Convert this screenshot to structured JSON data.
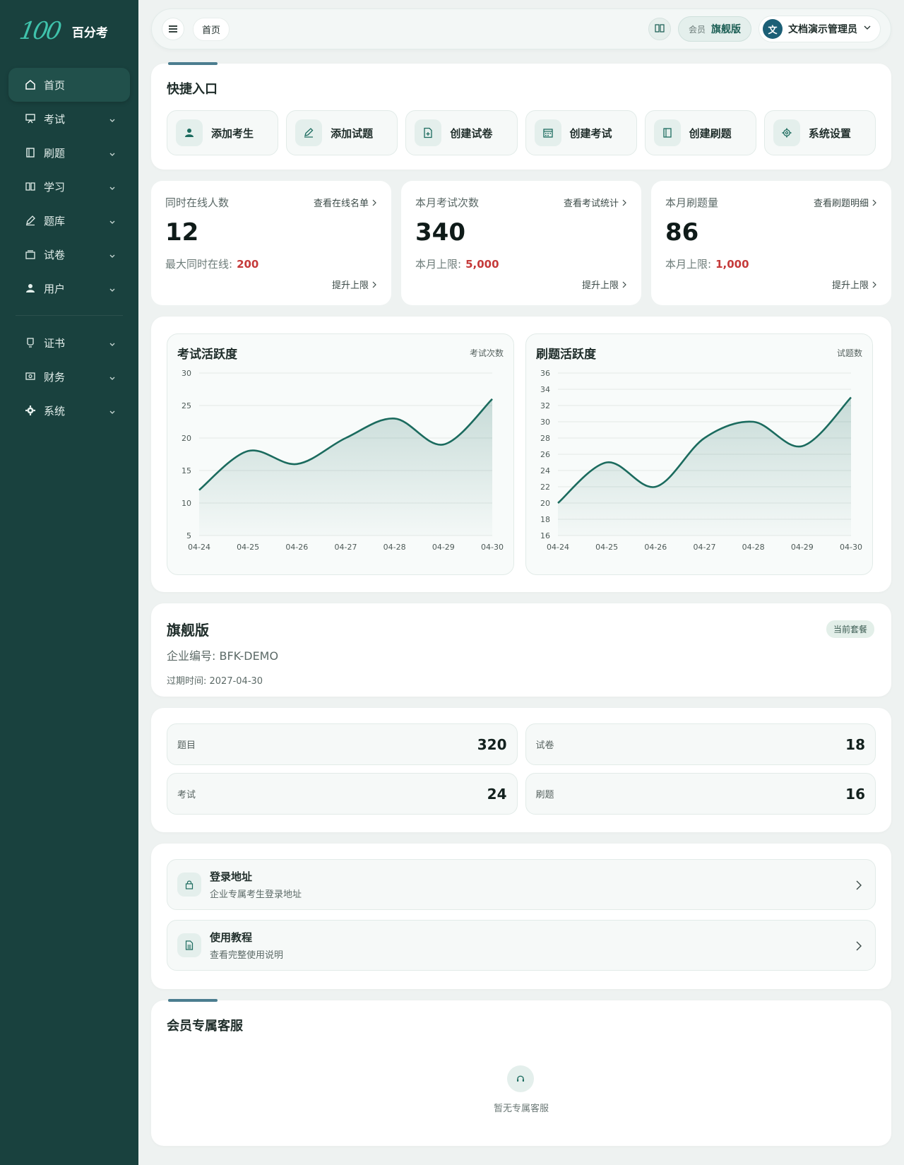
{
  "brand": {
    "logo_mark": "100",
    "name": "百分考"
  },
  "nav": [
    {
      "label": "首页",
      "icon": "home-icon",
      "active": true,
      "chevron": false
    },
    {
      "label": "考试",
      "icon": "presentation-icon",
      "chevron": true
    },
    {
      "label": "刷题",
      "icon": "notebook-icon",
      "chevron": true
    },
    {
      "label": "学习",
      "icon": "book-open-icon",
      "chevron": true
    },
    {
      "label": "题库",
      "icon": "pen-icon",
      "chevron": true
    },
    {
      "label": "试卷",
      "icon": "papers-icon",
      "chevron": true
    },
    {
      "label": "用户",
      "icon": "user-icon",
      "chevron": true
    },
    {
      "label": "证书",
      "icon": "certificate-icon",
      "chevron": true
    },
    {
      "label": "财务",
      "icon": "money-icon",
      "chevron": true
    },
    {
      "label": "系统",
      "icon": "gear-icon",
      "chevron": true
    }
  ],
  "topbar": {
    "breadcrumb": "首页",
    "member_label": "会员",
    "member_plan": "旗舰版",
    "avatar_letter": "文",
    "user_name": "文档演示管理员"
  },
  "quick": {
    "title": "快捷入口",
    "items": [
      {
        "label": "添加考生",
        "icon": "user-icon"
      },
      {
        "label": "添加试题",
        "icon": "pen-icon"
      },
      {
        "label": "创建试卷",
        "icon": "file-plus-icon"
      },
      {
        "label": "创建考试",
        "icon": "calendar-icon"
      },
      {
        "label": "创建刷题",
        "icon": "notebook-icon"
      },
      {
        "label": "系统设置",
        "icon": "gear-icon"
      }
    ]
  },
  "stats": [
    {
      "label": "同时在线人数",
      "link": "查看在线名单",
      "value": "12",
      "limit_label": "最大同时在线:",
      "limit_value": "200",
      "upgrade": "提升上限"
    },
    {
      "label": "本月考试次数",
      "link": "查看考试统计",
      "value": "340",
      "limit_label": "本月上限:",
      "limit_value": "5,000",
      "upgrade": "提升上限"
    },
    {
      "label": "本月刷题量",
      "link": "查看刷题明细",
      "value": "86",
      "limit_label": "本月上限:",
      "limit_value": "1,000",
      "upgrade": "提升上限"
    }
  ],
  "chart_data": [
    {
      "type": "area",
      "title": "考试活跃度",
      "unit": "考试次数",
      "categories": [
        "04-24",
        "04-25",
        "04-26",
        "04-27",
        "04-28",
        "04-29",
        "04-30"
      ],
      "values": [
        12,
        18,
        16,
        20,
        23,
        19,
        26
      ],
      "ylim": [
        5,
        30
      ],
      "yticks": [
        5,
        10,
        15,
        20,
        25,
        30
      ],
      "grid": true,
      "color": "#1b6b5e"
    },
    {
      "type": "area",
      "title": "刷题活跃度",
      "unit": "试题数",
      "categories": [
        "04-24",
        "04-25",
        "04-26",
        "04-27",
        "04-28",
        "04-29",
        "04-30"
      ],
      "values": [
        20,
        25,
        22,
        28,
        30,
        27,
        33
      ],
      "ylim": [
        16,
        36
      ],
      "yticks": [
        16,
        18,
        20,
        22,
        24,
        26,
        28,
        30,
        32,
        34,
        36
      ],
      "grid": true,
      "color": "#1b6b5e"
    }
  ],
  "plan": {
    "title": "旗舰版",
    "badge": "当前套餐",
    "company_id": "企业编号: BFK-DEMO",
    "expire": "过期时间: 2027-04-30"
  },
  "counts": [
    {
      "label": "题目",
      "value": "320"
    },
    {
      "label": "试卷",
      "value": "18"
    },
    {
      "label": "考试",
      "value": "24"
    },
    {
      "label": "刷题",
      "value": "16"
    }
  ],
  "links": [
    {
      "title": "登录地址",
      "sub": "企业专属考生登录地址",
      "icon": "lock-icon"
    },
    {
      "title": "使用教程",
      "sub": "查看完整使用说明",
      "icon": "document-icon"
    }
  ],
  "service": {
    "title": "会员专属客服",
    "empty": "暂无专属客服"
  }
}
